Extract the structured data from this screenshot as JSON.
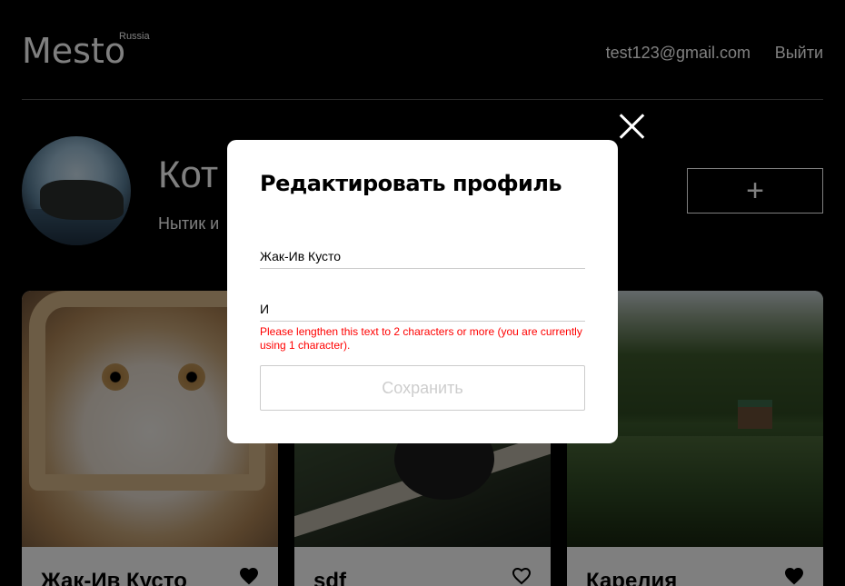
{
  "header": {
    "logo": "Mesto",
    "logo_sup": "Russia",
    "email": "test123@gmail.com",
    "logout": "Выйти"
  },
  "profile": {
    "name": "Кот",
    "about": "Нытик и",
    "add_button": "+"
  },
  "cards": [
    {
      "title": "Жак-Ив Кусто",
      "liked": true
    },
    {
      "title": "sdf",
      "liked": false
    },
    {
      "title": "Карелия",
      "liked": true
    }
  ],
  "popup": {
    "title": "Редактировать профиль",
    "name_value": "Жак-Ив Кусто",
    "about_value": "И",
    "error": "Please lengthen this text to 2 characters or more (you are currently using 1 character).",
    "save_label": "Сохранить"
  },
  "colors": {
    "overlay": "rgba(0,0,0,0.5)",
    "error": "#ff0000",
    "background": "#000000"
  }
}
